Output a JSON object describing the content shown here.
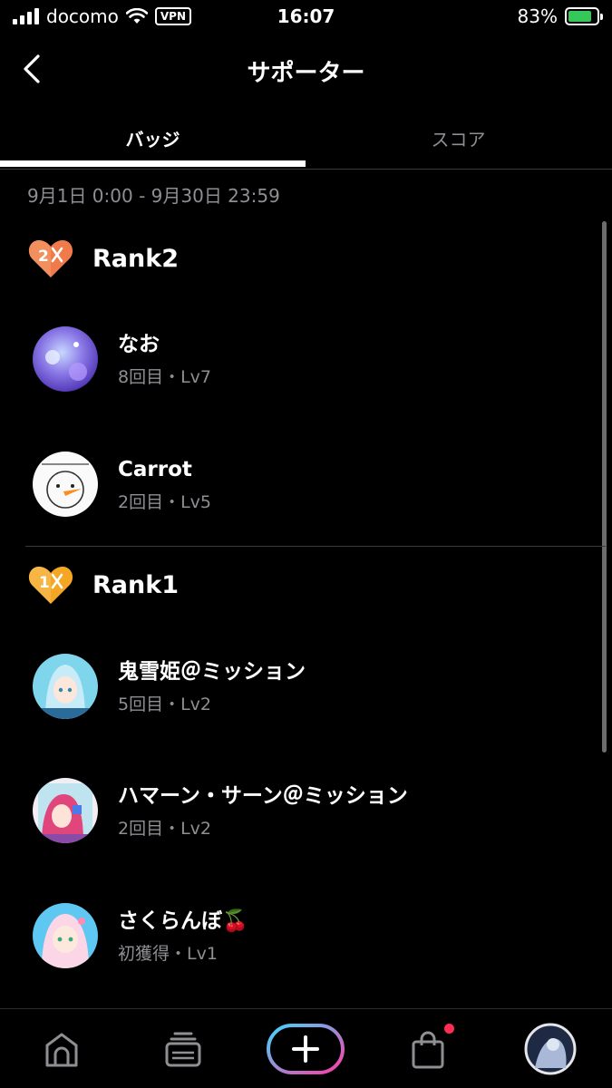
{
  "status_bar": {
    "carrier": "docomo",
    "vpn": "VPN",
    "time": "16:07",
    "battery": "83%",
    "battery_level": 0.83
  },
  "header": {
    "title": "サポーター"
  },
  "tabs": [
    {
      "label": "バッジ",
      "active": true
    },
    {
      "label": "スコア",
      "active": false
    }
  ],
  "period": "9月1日 0:00 - 9月30日 23:59",
  "ranks": [
    {
      "label": "Rank2",
      "badge_number": "2",
      "badge_color": "#f07a4a",
      "supporters": [
        {
          "name": "なお",
          "meta": "8回目・Lv7"
        },
        {
          "name": "Carrot",
          "meta": "2回目・Lv5"
        }
      ]
    },
    {
      "label": "Rank1",
      "badge_number": "1",
      "badge_color": "#f5a623",
      "supporters": [
        {
          "name": "鬼雪姫＠ミッション",
          "meta": "5回目・Lv2"
        },
        {
          "name": "ハマーン・サーン＠ミッション",
          "meta": "2回目・Lv2"
        },
        {
          "name": "さくらんぼ🍒",
          "meta": "初獲得・Lv1"
        }
      ]
    }
  ],
  "bottom_nav": {
    "items": [
      "home-icon",
      "cards-icon",
      "add-icon",
      "shop-icon",
      "profile-avatar"
    ],
    "accent_gradient": [
      "#3dd8ff",
      "#ff3ca8"
    ],
    "notification_color": "#ff2d55"
  }
}
